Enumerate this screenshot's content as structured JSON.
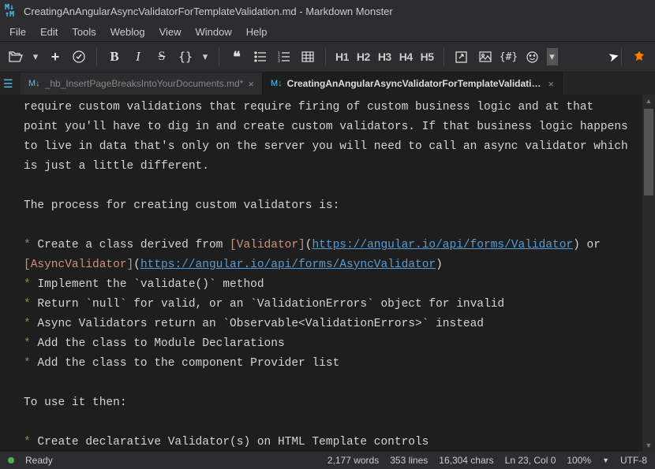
{
  "titlebar": {
    "title": "CreatingAnAngularAsyncValidatorForTemplateValidation.md  - Markdown Monster"
  },
  "menubar": [
    "File",
    "Edit",
    "Tools",
    "Weblog",
    "View",
    "Window",
    "Help"
  ],
  "toolbar": {
    "h1": "H1",
    "h2": "H2",
    "h3": "H3",
    "h4": "H4",
    "h5": "H5",
    "braces": "{#}"
  },
  "tabs": [
    {
      "label": "_hb_InsertPageBreaksIntoYourDocuments.md*",
      "active": false
    },
    {
      "label": "CreatingAnAngularAsyncValidatorForTemplateValidation.md*",
      "active": true
    }
  ],
  "editor": {
    "p1": "require custom validations that require firing of custom business logic and at that point you'll have to dig in and create custom validators. If that business logic happens to live in data that's only on the server you will need to call an async validator which is just a little different.",
    "p2": "The process for creating custom validators is:",
    "li1a": "Create a class derived from ",
    "li1b_label": "[Validator]",
    "li1b_url": "https://angular.io/api/forms/Validator",
    "li1c": " or ",
    "li1d_label": "[AsyncValidator]",
    "li1d_url": "https://angular.io/api/forms/AsyncValidator",
    "li2": "Implement the `validate()` method",
    "li3": "Return `null` for valid, or an `ValidationErrors` object for invalid",
    "li4": "Async Validators return an `Observable<ValidationErrors>` instead",
    "li5": "Add the class to Module Declarations",
    "li6": "Add the class to the component Provider list",
    "p3": "To use it then:",
    "li7": "Create declarative Validator(s) on HTML Template controls"
  },
  "status": {
    "ready": "Ready",
    "words": "2,177 words",
    "lines": "353 lines",
    "chars": "16,304 chars",
    "cursor": "Ln 23, Col 0",
    "zoom": "100%",
    "encoding": "UTF-8"
  }
}
